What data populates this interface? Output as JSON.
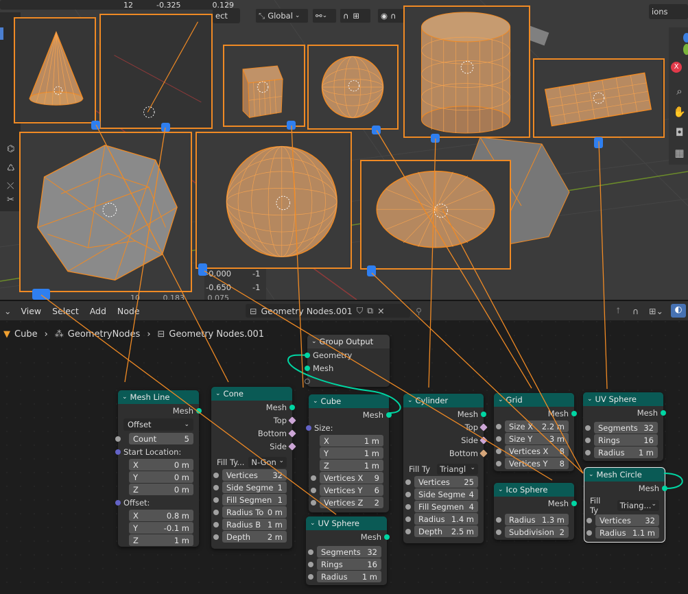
{
  "viewport": {
    "transform_orientation": "Global",
    "partial_labels": {
      "sect": "ect",
      "options": "ions"
    },
    "stats_top": [
      "12",
      "-0.325",
      "0.129"
    ],
    "stats_bottom": [
      "-0.000",
      "-1",
      "-0.650",
      "-1",
      "10",
      "0.183",
      "0.075"
    ]
  },
  "node_editor": {
    "menu": {
      "view": "View",
      "select": "Select",
      "add": "Add",
      "node": "Node"
    },
    "node_group_name": "Geometry Nodes.001",
    "breadcrumb": [
      "Cube",
      "GeometryNodes",
      "Geometry Nodes.001"
    ]
  },
  "nodes": {
    "group_output": {
      "title": "Group Output",
      "geometry": "Geometry",
      "mesh": "Mesh"
    },
    "mesh_line": {
      "title": "Mesh Line",
      "out": "Mesh",
      "mode": "Offset",
      "count_label": "Count",
      "count": "5",
      "start_label": "Start Location:",
      "start": [
        [
          "X",
          "0 m"
        ],
        [
          "Y",
          "0 m"
        ],
        [
          "Z",
          "0 m"
        ]
      ],
      "offset_label": "Offset:",
      "offset": [
        [
          "X",
          "0.8 m"
        ],
        [
          "Y",
          "-0.1 m"
        ],
        [
          "Z",
          "1 m"
        ]
      ]
    },
    "cone": {
      "title": "Cone",
      "outs": [
        "Mesh",
        "Top",
        "Bottom",
        "Side"
      ],
      "fill_label": "Fill Ty...",
      "fill": "N-Gon",
      "fields": [
        [
          "Vertices",
          "32"
        ],
        [
          "Side Segme",
          "1"
        ],
        [
          "Fill Segmen",
          "1"
        ],
        [
          "Radius To",
          "0 m"
        ],
        [
          "Radius B",
          "1 m"
        ],
        [
          "Depth",
          "2 m"
        ]
      ]
    },
    "cube": {
      "title": "Cube",
      "out": "Mesh",
      "size_label": "Size:",
      "size": [
        [
          "X",
          "1 m"
        ],
        [
          "Y",
          "1 m"
        ],
        [
          "Z",
          "1 m"
        ]
      ],
      "fields": [
        [
          "Vertices X",
          "9"
        ],
        [
          "Vertices Y",
          "6"
        ],
        [
          "Vertices Z",
          "2"
        ]
      ]
    },
    "uv_sphere_1": {
      "title": "UV Sphere",
      "out": "Mesh",
      "fields": [
        [
          "Segments",
          "32"
        ],
        [
          "Rings",
          "16"
        ],
        [
          "Radius",
          "1 m"
        ]
      ]
    },
    "cylinder": {
      "title": "Cylinder",
      "outs": [
        "Mesh",
        "Top",
        "Side",
        "Bottom"
      ],
      "fill_label": "Fill Ty",
      "fill": "Triangl",
      "fields": [
        [
          "Vertices",
          "25"
        ],
        [
          "Side Segme",
          "4"
        ],
        [
          "Fill Segmen",
          "4"
        ],
        [
          "Radius",
          "1.4 m"
        ],
        [
          "Depth",
          "2.5 m"
        ]
      ]
    },
    "grid": {
      "title": "Grid",
      "out": "Mesh",
      "fields": [
        [
          "Size X",
          "2.2 m"
        ],
        [
          "Size Y",
          "3 m"
        ],
        [
          "Vertices X",
          "8"
        ],
        [
          "Vertices Y",
          "8"
        ]
      ]
    },
    "ico_sphere": {
      "title": "Ico Sphere",
      "out": "Mesh",
      "fields": [
        [
          "Radius",
          "1.3 m"
        ],
        [
          "Subdivision",
          "2"
        ]
      ]
    },
    "uv_sphere_2": {
      "title": "UV Sphere",
      "out": "Mesh",
      "fields": [
        [
          "Segments",
          "32"
        ],
        [
          "Rings",
          "16"
        ],
        [
          "Radius",
          "1 m"
        ]
      ]
    },
    "mesh_circle": {
      "title": "Mesh Circle",
      "out": "Mesh",
      "fill_label": "Fill Ty",
      "fill": "Triang...",
      "fields": [
        [
          "Vertices",
          "32"
        ],
        [
          "Radius",
          "1.1 m"
        ]
      ]
    }
  },
  "colors": {
    "selection_orange": "#f08a24",
    "geometry_socket": "#00d6a3",
    "vector_socket": "#6363c7",
    "float_socket": "#a1a1a1",
    "node_header": "#0a5a55",
    "callout_blue": "#2f7ff0"
  }
}
